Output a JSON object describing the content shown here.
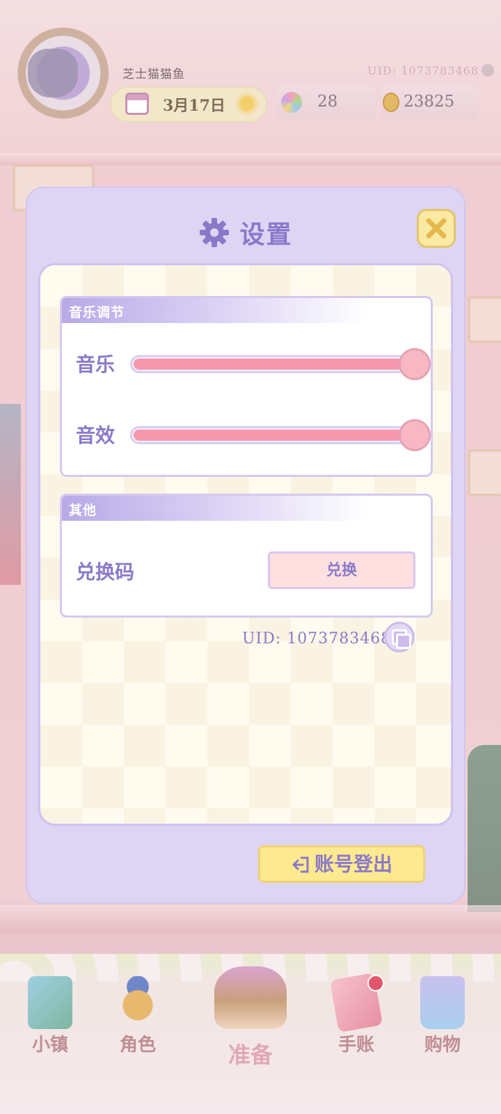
{
  "header": {
    "player_name": "芝士猫猫鱼",
    "uid_label": "UID: 1073783468",
    "date": "3月17日",
    "gems": "28",
    "coins": "23825"
  },
  "dialog": {
    "title": "设置",
    "music_section": {
      "header": "音乐调节",
      "music_label": "音乐",
      "music_level": 1.0,
      "sfx_label": "音效",
      "sfx_level": 1.0
    },
    "other_section": {
      "header": "其他",
      "redeem_label": "兑换码",
      "redeem_button": "兑换"
    },
    "uid_text": "UID: 1073783468",
    "logout_button": "账号登出"
  },
  "bottom_nav": {
    "items": [
      {
        "label": "小镇",
        "icon": "map-icon"
      },
      {
        "label": "角色",
        "icon": "character-icon"
      },
      {
        "label": "准备",
        "icon": "basket-icon"
      },
      {
        "label": "手账",
        "icon": "journal-icon"
      },
      {
        "label": "购物",
        "icon": "shopping-bag-icon"
      }
    ]
  },
  "colors": {
    "dialog_bg": "#ded4f3",
    "accent_text": "#8a79c9",
    "slider_fill": "#f797ad",
    "logout_bg": "#fde98f",
    "close_bg": "#fbeaa3"
  }
}
